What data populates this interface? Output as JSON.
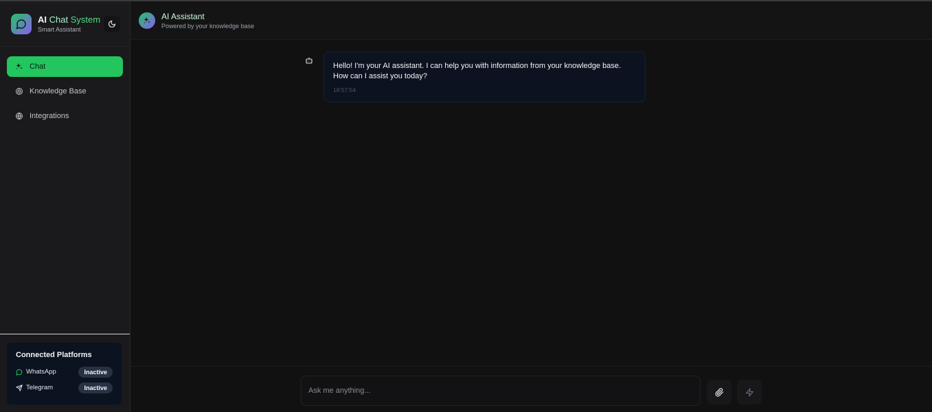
{
  "brand": {
    "title_part1": "AI",
    "title_part2": "Chat",
    "title_part3": "System",
    "subtitle": "Smart Assistant"
  },
  "nav": {
    "items": [
      {
        "label": "Chat",
        "icon": "sparkles-icon",
        "active": true
      },
      {
        "label": "Knowledge Base",
        "icon": "brain-icon",
        "active": false
      },
      {
        "label": "Integrations",
        "icon": "globe-icon",
        "active": false
      }
    ]
  },
  "platforms": {
    "title": "Connected Platforms",
    "items": [
      {
        "name": "WhatsApp",
        "status": "Inactive",
        "icon": "message-circle-icon"
      },
      {
        "name": "Telegram",
        "status": "Inactive",
        "icon": "send-icon"
      }
    ]
  },
  "header": {
    "title": "AI Assistant",
    "subtitle": "Powered by your knowledge base"
  },
  "messages": [
    {
      "sender": "bot",
      "text": "Hello! I'm your AI assistant. I can help you with information from your knowledge base. How can I assist you today?",
      "time": "18:57:54"
    }
  ],
  "composer": {
    "placeholder": "Ask me anything..."
  },
  "colors": {
    "accent": "#22c55e",
    "sidebar_bg": "#1a191c",
    "main_bg": "#111112",
    "bubble_bg": "#0c1220"
  }
}
